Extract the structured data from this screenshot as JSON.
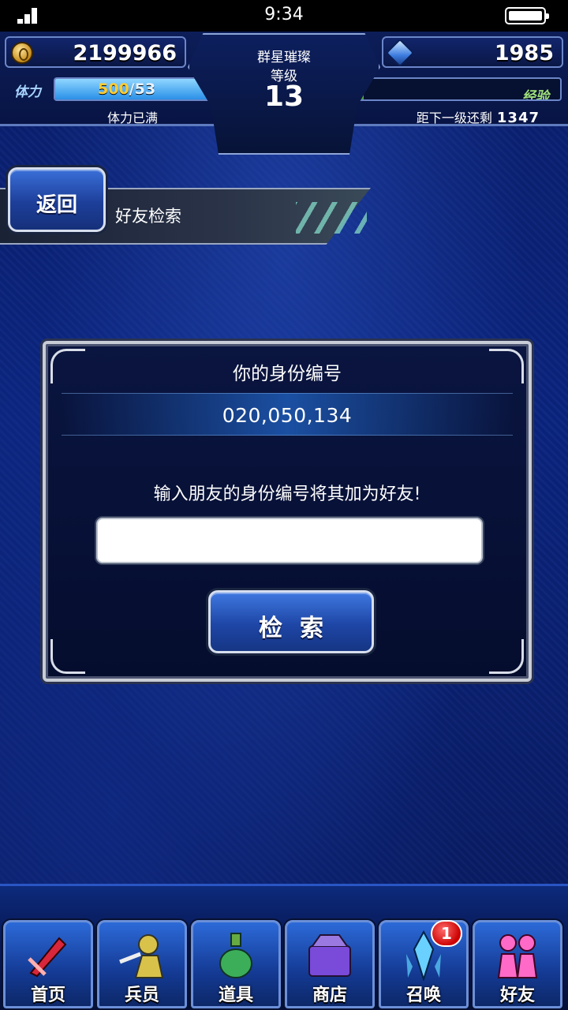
{
  "status_bar": {
    "time": "9:34"
  },
  "hud": {
    "gil": "2199966",
    "gems": "1985",
    "rank_title": "群星璀璨",
    "rank_label": "等级",
    "rank_level": "13",
    "stamina_label": "体力",
    "stamina_current": "500",
    "stamina_max": "/53",
    "stamina_status": "体力已满",
    "stamina_fill_fraction": 1.0,
    "exp_label": "经验",
    "exp_remain_label": "距下一级还剩",
    "exp_remain_value": "1347",
    "exp_fill_fraction": 0.11
  },
  "header": {
    "back_label": "返回",
    "title": "好友检索"
  },
  "dialog": {
    "id_heading": "你的身份编号",
    "id_value": "020,050,134",
    "hint": "输入朋友的身份编号将其加为好友!",
    "input_value": "",
    "input_placeholder": "",
    "search_label": "检索"
  },
  "nav": {
    "items": [
      {
        "label": "首页",
        "icon": "sword-icon",
        "color": "#d8263a"
      },
      {
        "label": "兵员",
        "icon": "hero-icon",
        "color": "#d8c24a"
      },
      {
        "label": "道具",
        "icon": "potion-icon",
        "color": "#3cae5a"
      },
      {
        "label": "商店",
        "icon": "shop-icon",
        "color": "#7a4ad8"
      },
      {
        "label": "召唤",
        "icon": "crystal-icon",
        "color": "#6ad0ff"
      },
      {
        "label": "好友",
        "icon": "friends-icon",
        "color": "#ff6ac8"
      }
    ],
    "summon_badge": "1"
  }
}
